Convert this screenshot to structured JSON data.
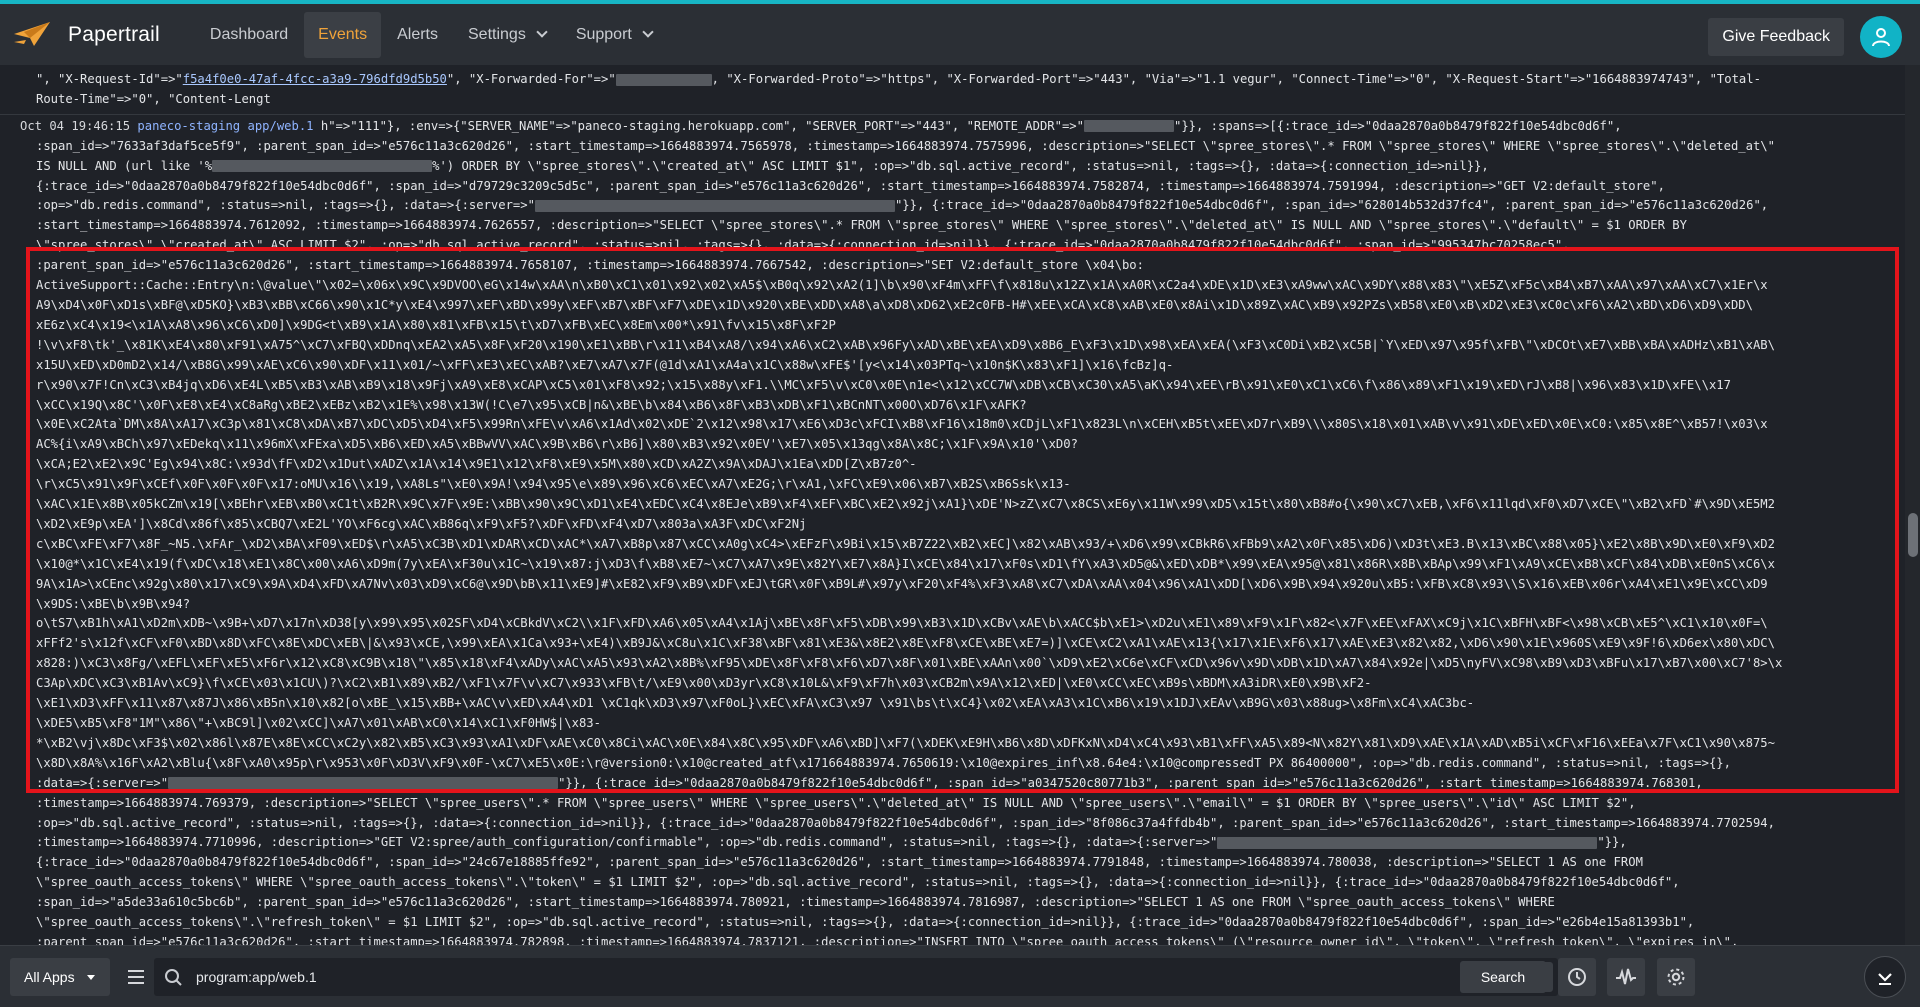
{
  "app": {
    "brand": "Papertrail"
  },
  "nav": {
    "dashboard": "Dashboard",
    "events": "Events",
    "alerts": "Alerts",
    "settings": "Settings",
    "support": "Support"
  },
  "header": {
    "feedback": "Give Feedback"
  },
  "log": {
    "l0": "\", \"X-Request-Id\"=>\"",
    "l0_link": "f5a4f0e0-47af-4fcc-a3a9-796dfd9d5b50",
    "l0b": "\", \"X-Forwarded-For\"=>\"",
    "l0c": ", \"X-Forwarded-Proto\"=>\"https\", \"X-Forwarded-Port\"=>\"443\", \"Via\"=>\"1.1 vegur\", \"Connect-Time\"=>\"0\", \"X-Request-Start\"=>\"1664883974743\", \"Total-",
    "l1": "Route-Time\"=>\"0\", \"Content-Lengt",
    "l2_time": "Oct 04 19:46:15",
    "l2_host": "paneco-staging",
    "l2_prog": "app/web.1",
    "l2_rest": "h\"=>\"111\"}, :env=>{\"SERVER_NAME\"=>\"paneco-staging.herokuapp.com\", \"SERVER_PORT\"=>\"443\", \"REMOTE_ADDR\"=>\"",
    "l2_end": "\"}}, :spans=>[{:trace_id=>\"0daa2870a0b8479f822f10e54dbc0d6f\",",
    "l3": ":span_id=>\"7633af3daf5ce5f9\", :parent_span_id=>\"e576c11a3c620d26\", :start_timestamp=>1664883974.7565978, :timestamp=>1664883974.7575996, :description=>\"SELECT \\\"spree_stores\\\".* FROM \\\"spree_stores\\\" WHERE \\\"spree_stores\\\".\\\"deleted_at\\\"",
    "l4": "IS NULL AND (url like '%",
    "l4b": "%') ORDER BY \\\"spree_stores\\\".\\\"created_at\\\" ASC LIMIT $1\", :op=>\"db.sql.active_record\", :status=>nil, :tags=>{}, :data=>{:connection_id=>nil}},",
    "l5": "{:trace_id=>\"0daa2870a0b8479f822f10e54dbc0d6f\", :span_id=>\"d79729c3209c5d5c\", :parent_span_id=>\"e576c11a3c620d26\", :start_timestamp=>1664883974.7582874, :timestamp=>1664883974.7591994, :description=>\"GET V2:default_store\",",
    "l6": ":op=>\"db.redis.command\", :status=>nil, :tags=>{}, :data=>{:server=>\"",
    "l6b": "\"}}, {:trace_id=>\"0daa2870a0b8479f822f10e54dbc0d6f\", :span_id=>\"628014b532d37fc4\", :parent_span_id=>\"e576c11a3c620d26\",",
    "l7": ":start_timestamp=>1664883974.7612092, :timestamp=>1664883974.7626557, :description=>\"SELECT \\\"spree_stores\\\".* FROM \\\"spree_stores\\\" WHERE \\\"spree_stores\\\".\\\"deleted_at\\\" IS NULL AND \\\"spree_stores\\\".\\\"default\\\" = $1 ORDER BY",
    "l8": "\\\"spree_stores\\\".\\\"created_at\\\" ASC LIMIT $2\", :op=>\"db.sql.active_record\", :status=>nil, :tags=>{}, :data=>{:connection_id=>nil}}, {:trace_id=>\"0daa2870a0b8479f822f10e54dbc0d6f\", :span_id=>\"995347bc70258ec5\",",
    "l9": ":parent_span_id=>\"e576c11a3c620d26\", :start_timestamp=>1664883974.7658107, :timestamp=>1664883974.7667542, :description=>\"SET V2:default_store \\x04\\bo:",
    "l10": "ActiveSupport::Cache::Entry\\n:\\@value\\\"\\x02=\\x06x\\x9C\\x9DVOO\\eG\\x14w\\xAA\\n\\xB0\\xC1\\x01\\x92\\x02\\xA5$\\xB0q\\x92\\xA2(1]\\b\\x90\\xF4m\\xFF\\f\\x818u\\x12Z\\x1A\\xA0R\\xC2a4\\xDE\\x1D\\xE3\\xA9ww\\xAC\\x9DY\\x88\\x83\\\"\\xE5Z\\xF5c\\xB4\\xB7\\xAA\\x97\\xAA\\xC7\\x1Er\\x",
    "l11": "A9\\xD4\\x0F\\xD1s\\xBF@\\xD5KO}\\xB3\\xBB\\xC66\\x90\\x1C*y\\xE4\\x997\\xEF\\xBD\\x99y\\xEF\\xB7\\xBF\\xF7\\xDE\\x1D\\x920\\xBE\\xDD\\xA8\\a\\xD8\\xD62\\xE2c0FB-H#\\xEE\\xCA\\xC8\\xAB\\xE0\\x8Ai\\x1D\\x89Z\\xAC\\xB9\\x92PZs\\xB58\\xE0\\xB\\xD2\\xE3\\xC0c\\xF6\\xA2\\xBD\\xD6\\xD9\\xDD\\",
    "l12": "xE6z\\xC4\\x19<\\x1A\\xA8\\x96\\xC6\\xD0]\\x9DG<t\\xB9\\x1A\\x80\\x81\\xFB\\x15\\t\\xD7\\xFB\\xEC\\x8Em\\x00*\\x91\\fv\\x15\\x8F\\xF2P",
    "l13": "!\\v\\xF8\\tk'_\\x81K\\xE4\\x80\\xF91\\xA75^\\xC7\\xFBQ\\xDDnq\\xEA2\\xA5\\x8F\\xF20\\x190\\xE1\\xBB\\r\\x11\\xB4\\xA8/\\x94\\xA6\\xC2\\xAB\\x96Fy\\xAD\\xBE\\xEA\\xD9\\x8B6_E\\xF3\\x1D\\x98\\xEA\\xEA(\\xF3\\xC0Di\\xB2\\xC5B|`Y\\xED\\x97\\x95f\\xFB\\\"\\xDCOt\\xE7\\xBB\\xBA\\xADHz\\xB1\\xAB\\",
    "l14": "x15U\\xED\\xD0mD2\\x14/\\xB8G\\x99\\xAE\\xC6\\x90\\xDF\\x11\\x01/~\\xFF\\xE3\\xEC\\xAB?\\xE7\\xA7\\x7F(@1d\\xA1\\xA4a\\x1C\\x88w\\xFE$'[y<\\x14\\x03PTq~\\x10n$K\\x83\\xF1]\\x16\\fcBz]q-",
    "l15": "r\\x90\\x7F!Cn\\xC3\\xB4jq\\xD6\\xE4L\\xB5\\xB3\\xAB\\xB9\\x18\\x9Fj\\xA9\\xE8\\xCAP\\xC5\\x01\\xF8\\x92;\\x15\\x88y\\xF1.\\\\MC\\xF5\\v\\xC0\\x0E\\n1e<\\x12\\xCC7W\\xDB\\xCB\\xC30\\xA5\\aK\\x94\\xEE\\rB\\x91\\xE0\\xC1\\xC6\\f\\x86\\x89\\xF1\\x19\\xED\\rJ\\xB8|\\x96\\x83\\x1D\\xFE\\\\x17",
    "l16": "\\xCC\\x19Q\\x8C'\\x0F\\xE8\\xE4\\xC8aRg\\xBE2\\xEBz\\xB2\\x1E%\\x98\\x13W(!C\\e7\\x95\\xCB|n&\\xBE\\b\\x84\\xB6\\x8F\\xB3\\xDB\\xF1\\xBCnNT\\x00O\\xD76\\x1F\\xAFK?",
    "l17": "\\x0E\\xC2Ata`DM\\x8A\\xA17\\xC3p\\x81\\xC8\\xDA\\xB7\\xDC\\xD5\\xD4\\xF5\\x99Rn\\xFE\\v\\xA6\\x1Ad\\x02\\xDE`2\\x12\\x98\\x17\\xE6\\xD3c\\xFCI\\xB8\\xF16\\x18m0\\xCDjL\\xF1\\x823L\\n\\xCEH\\xB5t\\xEE\\xD7r\\xB9\\\\\\x80S\\x18\\x01\\xAB\\v\\x91\\xDE\\xED\\x0E\\xC0:\\x85\\x8E^\\xB57!\\x03\\x",
    "l18": "AC%{i\\xA9\\xBCh\\x97\\xEDekq\\x11\\x96mX\\xFExa\\xD5\\xB6\\xED\\xA5\\xBBwVV\\xAC\\x9B\\xB6\\r\\xB6]\\x80\\xB3\\x92\\x0EV'\\xE7\\x05\\x13qg\\x8A\\x8C;\\x1F\\x9A\\x10'\\xD0?",
    "l19": "\\xCA;E2\\xE2\\x9C'Eg\\x94\\x8C:\\x93d\\fF\\xD2\\x1Dut\\xADZ\\x1A\\x14\\x9E1\\x12\\xF8\\xE9\\x5M\\x80\\xCD\\xA2Z\\x9A\\xDAJ\\x1Ea\\xDD[Z\\xB7z0^-",
    "l20": "\\r\\xC5\\x91\\x9F\\xCEf\\x0F\\x0F\\x0F\\x17:oMU\\x16\\\\x19,\\xA8Ls\"\\xE0\\x9A!\\x94\\x95\\e\\x89\\x96\\xC6\\xEC\\xA7\\xE2G;\\r\\xA1,\\xFC\\xE9\\x06\\xB7\\xB2S\\xB6Ssk\\x13-",
    "l21": "\\xAC\\x1E\\x8B\\x05kCZm\\x19[\\xBEhr\\xEB\\xB0\\xC1t\\xB2R\\x9C\\x7F\\x9E:\\xBB\\x90\\x9C\\xD1\\xE4\\xEDC\\xC4\\x8EJe\\xB9\\xF4\\xEF\\xBC\\xE2\\x92j\\xA1}\\xDE'N>zZ\\xC7\\x8CS\\xE6y\\x11W\\x99\\xD5\\x15t\\x80\\xB8#o{\\x90\\xC7\\xEB,\\xF6\\x11lqd\\xF0\\xD7\\xCE\\\"\\xB2\\xFD`#\\x9D\\xE5M2",
    "l22": "\\xD2\\xE9p\\xEA']\\x8Cd\\x86f\\x85\\xCBQ7\\xE2L'YO\\xF6cg\\xAC\\xB86q\\xF9\\xF5?\\xDF\\xFD\\xF4\\xD7\\x803a\\xA3F\\xDC\\xF2Nj",
    "l23": "c\\xBC\\xFE\\xF7\\x8F_~N5.\\xFAr_\\xD2\\xBA\\xF09\\xED$\\r\\xA5\\xC3B\\xD1\\xDAR\\xCD\\xAC*\\xA7\\xB8p\\x87\\xCC\\xA0g\\xC4>\\xEFzF\\x9Bi\\x15\\xB7Z22\\xB2\\xEC]\\x82\\xAB\\x93/+\\xD6\\x99\\xCBkR6\\xFBb9\\xA2\\x0F\\x85\\xD6)\\xD3t\\xE3.B\\x13\\xBC\\x88\\x05}\\xE2\\x8B\\x9D\\xE0\\xF9\\xD2",
    "l24": "\\x10@*\\x1C\\xE4\\x19(f\\xDC\\x18\\xE1\\x8C\\x00\\xA6\\xD9m(7y\\xEA\\xF30u\\x1C~\\x19\\x87:j\\xD3\\f\\xB8\\xE7~\\xC7\\xA7\\x9E\\x82Y\\xE7\\x8A}I\\xCE\\x84\\x17\\xF0s\\xD1\\fY\\xA3\\xD5@&\\xED\\xDB*\\x99\\xEA\\x95@\\x81\\x86R\\x8B\\xBAp\\x99\\xF1\\xA9\\xCE\\xB8\\xCF\\x84\\xDB\\xE0nS\\xC6\\x",
    "l25": "9A\\x1A>\\xCEnc\\x92g\\x80\\x17\\xC9\\x9A\\xD4\\xFD\\xA7Nv\\x03\\xD9\\xC6@\\x9D\\bB\\x11\\xE9]#\\xE82\\xF9\\xB9\\xDF\\xEJ\\tGR\\x0F\\xB9L#\\x97y\\xF20\\xF4%\\xF3\\xA8\\xC7\\xDA\\xAA\\x04\\x96\\xA1\\xDD[\\xD6\\x9B\\x94\\x920u\\xB5:\\xFB\\xC8\\x93\\\\S\\x16\\xEB\\x06r\\xA4\\xE1\\x9E\\xCC\\xD9",
    "l26": "\\x9DS:\\xBE\\b\\x9B\\x94?",
    "l27": "o\\tS7\\xB1h\\xA1\\xD2m\\xDB~\\x9B+\\xD7\\x17n\\xD38[y\\x99\\x95\\x02SF\\xD4\\xCBkdV\\xC2\\\\x1F\\xFD\\xA6\\x05\\xA4\\x1Aj\\xBE\\x8F\\xF5\\xDB\\x99\\xB3\\x1D\\xCBv\\xAE\\b\\xACC$b\\xE1>\\xD2u\\xE1\\x89\\xF9\\x1F\\x82<\\x7F\\xEE\\xFAX\\xC9j\\x1C\\xBFH\\xBF<\\x98\\xCB\\xE5^\\xC1\\x10\\x0F=\\",
    "l28": "xFFf2's\\x12f\\xCF\\xF0\\xBD\\x8D\\xFC\\x8E\\xDC\\xEB\\|&\\x93\\xCE,\\x99\\xEA\\x1Ca\\x93+\\xE4)\\xB9J&\\xC8u\\x1C\\xF38\\xBF\\x81\\xE3&\\x8E2\\x8E\\xF8\\xCE\\xBE\\xE7=)]\\xCE\\xC2\\xA1\\xAE\\x13{\\x17\\x1E\\xF6\\x17\\xAE\\xE3\\x82\\x82,\\xD6\\x90\\x1E\\x960S\\xE9\\x9F!6\\xD6ex\\x80\\xDC\\",
    "l29": "x828:)\\xC3\\x8Fg/\\xEFL\\xEF\\xE5\\xF6r\\x12\\xC8\\xC9B\\x18\\\"\\x85\\x18\\xF4\\xADy\\xAC\\xA5\\x93\\xA2\\x8B%\\xF95\\xDE\\x8F\\xF8\\xF6\\xD7\\x8F\\x01\\xBE\\xAAn\\x00`\\xD9\\xE2\\xC6e\\xCF\\xCD\\x96v\\x9D\\xDB\\x1D\\xA7\\x84\\x92e|\\xD5\\nyFV\\xC98\\xB9\\xD3\\xBFu\\x17\\xB7\\x00\\xC7'8>\\x",
    "l30": "C3Ap\\xDC\\xC3\\xB1Av\\xC9}\\f\\xCE\\x03\\x1CU\\)?\\xC2\\xB1\\x89\\xB2/\\xF1\\x7F\\v\\xC7\\x933\\xFB\\t/\\xE9\\x00\\xD3yr\\xC8\\x10L&\\xF9\\xF7h\\x03\\xCB2m\\x9A\\x12\\xED|\\xE0\\xCC\\xEC\\xB9s\\xBDM\\xA3iDR\\xE0\\x9B\\xF2-",
    "l31": "\\xE1\\xD3\\xFF\\x11\\x87\\x87J\\x86\\xB5n\\x10\\x82[o\\xBE_\\x15\\xBB+\\xAC\\v\\xED\\xA4\\xD1 \\xC1qk\\xD3\\x97\\xF0oL}\\xEC\\xFA\\xC3\\x97 \\x91\\bs\\t\\xC4}\\x02\\xEA\\xA3\\x1C\\xB6\\x19\\x1DJ\\xEAv\\xB9G\\x03\\x88ug>\\x8Fm\\xC4\\xAC3bc-",
    "l32": "\\xDE5\\xB5\\xF8\"1M\"\\x86\\\"+\\xBC9l]\\x02\\xCC]\\xA7\\x01\\xAB\\xC0\\x14\\xC1\\xF0HW$|\\x83-",
    "l33": "*\\xB2\\vj\\x8Dc\\xF3$\\x02\\x86l\\x87E\\x8E\\xCC\\xC2y\\x82\\xB5\\xC3\\x93\\xA1\\xDF\\xAE\\xC0\\x8Ci\\xAC\\x0E\\x84\\x8C\\x95\\xDF\\xA6\\xBD]\\xF7(\\xDEK\\xE9H\\xB6\\x8D\\xDFKxN\\xD4\\xC4\\x93\\xB1\\xFF\\xA5\\x89<N\\x82Y\\x81\\xD9\\xAE\\x1A\\xAD\\xB5i\\xCF\\xF16\\xEEa\\x7F\\xC1\\x90\\x875~",
    "l34": "\\x8D\\x8A%\\x16F\\xA2\\xBlu{\\x8F\\xA0\\x95p\\r\\x953\\x0F\\xD3V\\xF9\\x0F-\\xC7\\xE5\\x0E:\\r@version0:\\x10@created_atf\\x171664883974.7650619:\\x10@expires_inf\\x8.64e4:\\x10@compressedT PX 86400000\", :op=>\"db.redis.command\", :status=>nil, :tags=>{},",
    "l35": ":data=>{:server=>\"",
    "l35b": "\"}}, {:trace_id=>\"0daa2870a0b8479f822f10e54dbc0d6f\", :span_id=>\"a0347520c80771b3\", :parent_span_id=>\"e576c11a3c620d26\", :start_timestamp=>1664883974.768301,",
    "l36": ":timestamp=>1664883974.769379, :description=>\"SELECT \\\"spree_users\\\".* FROM \\\"spree_users\\\" WHERE \\\"spree_users\\\".\\\"deleted_at\\\" IS NULL AND \\\"spree_users\\\".\\\"email\\\" = $1 ORDER BY \\\"spree_users\\\".\\\"id\\\" ASC LIMIT $2\",",
    "l37": ":op=>\"db.sql.active_record\", :status=>nil, :tags=>{}, :data=>{:connection_id=>nil}}, {:trace_id=>\"0daa2870a0b8479f822f10e54dbc0d6f\", :span_id=>\"8f086c37a4ffdb4b\", :parent_span_id=>\"e576c11a3c620d26\", :start_timestamp=>1664883974.7702594,",
    "l38": ":timestamp=>1664883974.7710996, :description=>\"GET V2:spree/auth_configuration/confirmable\", :op=>\"db.redis.command\", :status=>nil, :tags=>{}, :data=>{:server=>\"",
    "l38b": "\"}},",
    "l39": "{:trace_id=>\"0daa2870a0b8479f822f10e54dbc0d6f\", :span_id=>\"24c67e18885ffe92\", :parent_span_id=>\"e576c11a3c620d26\", :start_timestamp=>1664883974.7791848, :timestamp=>1664883974.780038, :description=>\"SELECT 1 AS one FROM",
    "l40": "\\\"spree_oauth_access_tokens\\\" WHERE \\\"spree_oauth_access_tokens\\\".\\\"token\\\" = $1 LIMIT $2\", :op=>\"db.sql.active_record\", :status=>nil, :tags=>{}, :data=>{:connection_id=>nil}}, {:trace_id=>\"0daa2870a0b8479f822f10e54dbc0d6f\",",
    "l41": ":span_id=>\"a5de33a610c5bc6b\", :parent_span_id=>\"e576c11a3c620d26\", :start_timestamp=>1664883974.780921, :timestamp=>1664883974.7816987, :description=>\"SELECT 1 AS one FROM \\\"spree_oauth_access_tokens\\\" WHERE",
    "l42": "\\\"spree_oauth_access_tokens\\\".\\\"refresh_token\\\" = $1 LIMIT $2\", :op=>\"db.sql.active_record\", :status=>nil, :tags=>{}, :data=>{:connection_id=>nil}}, {:trace_id=>\"0daa2870a0b8479f822f10e54dbc0d6f\", :span_id=>\"e26b4e15a81393b1\",",
    "l43": ":parent_span_id=>\"e576c11a3c620d26\", :start_timestamp=>1664883974.782898, :timestamp=>1664883974.7837121, :description=>\"INSERT INTO \\\"spree_oauth_access_tokens\\\" (\\\"resource_owner_id\\\", \\\"token\\\", \\\"refresh_token\\\", \\\"expires_in\\\","
  },
  "footer": {
    "apps_label": "All Apps",
    "search_value": "program:app/web.1",
    "search_button": "Search"
  },
  "colors": {
    "accent": "#17b5c4",
    "active_nav": "#f0a33a",
    "highlight": "#e4141b",
    "avatar": "#11b3c6"
  },
  "icons": [
    "papertrail-logo-icon",
    "chevron-down-icon",
    "user-icon",
    "menu-icon",
    "search-icon",
    "clear-icon",
    "bookmark-icon",
    "clock-icon",
    "activity-icon",
    "gear-icon",
    "chevron-down-circle-icon"
  ]
}
